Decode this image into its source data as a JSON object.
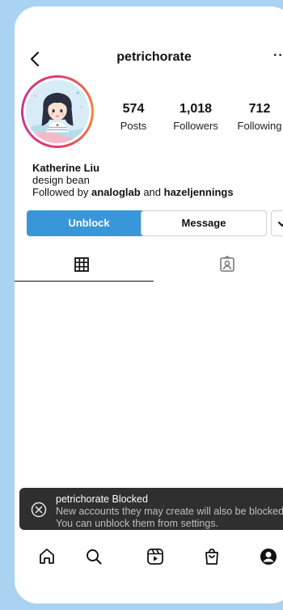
{
  "header": {
    "username": "petrichorate",
    "more_label": "···"
  },
  "profile": {
    "stats": [
      {
        "value": "574",
        "label": "Posts"
      },
      {
        "value": "1,018",
        "label": "Followers"
      },
      {
        "value": "712",
        "label": "Following"
      }
    ],
    "name": "Katherine Liu",
    "bio": "design bean",
    "followed_by_prefix": "Followed by",
    "followed_by_user1": "analoglab",
    "followed_by_and": "and",
    "followed_by_user2": "hazeljennings"
  },
  "actions": {
    "unblock_label": "Unblock",
    "message_label": "Message"
  },
  "tabs": [
    "grid-icon",
    "tagged-icon"
  ],
  "toast": {
    "title": "petrichorate Blocked",
    "body": "New accounts they may create will also be blocked. You can unblock them from settings."
  },
  "bottom_nav": [
    "home-icon",
    "search-icon",
    "reels-icon",
    "shop-icon",
    "profile-icon"
  ],
  "colors": {
    "background": "#a9d3f0",
    "accent": "#3897d9",
    "toast_bg": "#2f2f2f"
  }
}
